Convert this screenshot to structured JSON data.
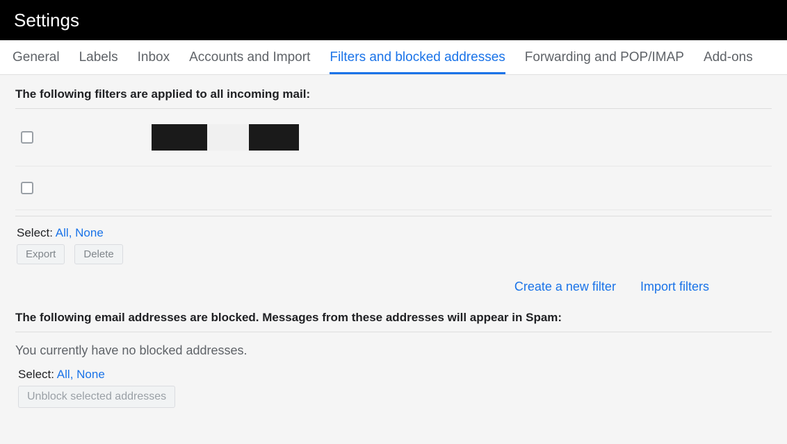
{
  "header": {
    "title": "Settings"
  },
  "tabs": [
    {
      "label": "General"
    },
    {
      "label": "Labels"
    },
    {
      "label": "Inbox"
    },
    {
      "label": "Accounts and Import"
    },
    {
      "label": "Filters and blocked addresses"
    },
    {
      "label": "Forwarding and POP/IMAP"
    },
    {
      "label": "Add-ons"
    }
  ],
  "filters": {
    "heading": "The following filters are applied to all incoming mail:",
    "select_label": "Select:",
    "select_all": "All",
    "select_none": "None",
    "export_label": "Export",
    "delete_label": "Delete",
    "create_new": "Create a new filter",
    "import": "Import filters"
  },
  "blocked": {
    "heading": "The following email addresses are blocked. Messages from these addresses will appear in Spam:",
    "empty_message": "You currently have no blocked addresses.",
    "select_label": "Select:",
    "select_all": "All",
    "select_none": "None",
    "unblock_label": "Unblock selected addresses"
  }
}
